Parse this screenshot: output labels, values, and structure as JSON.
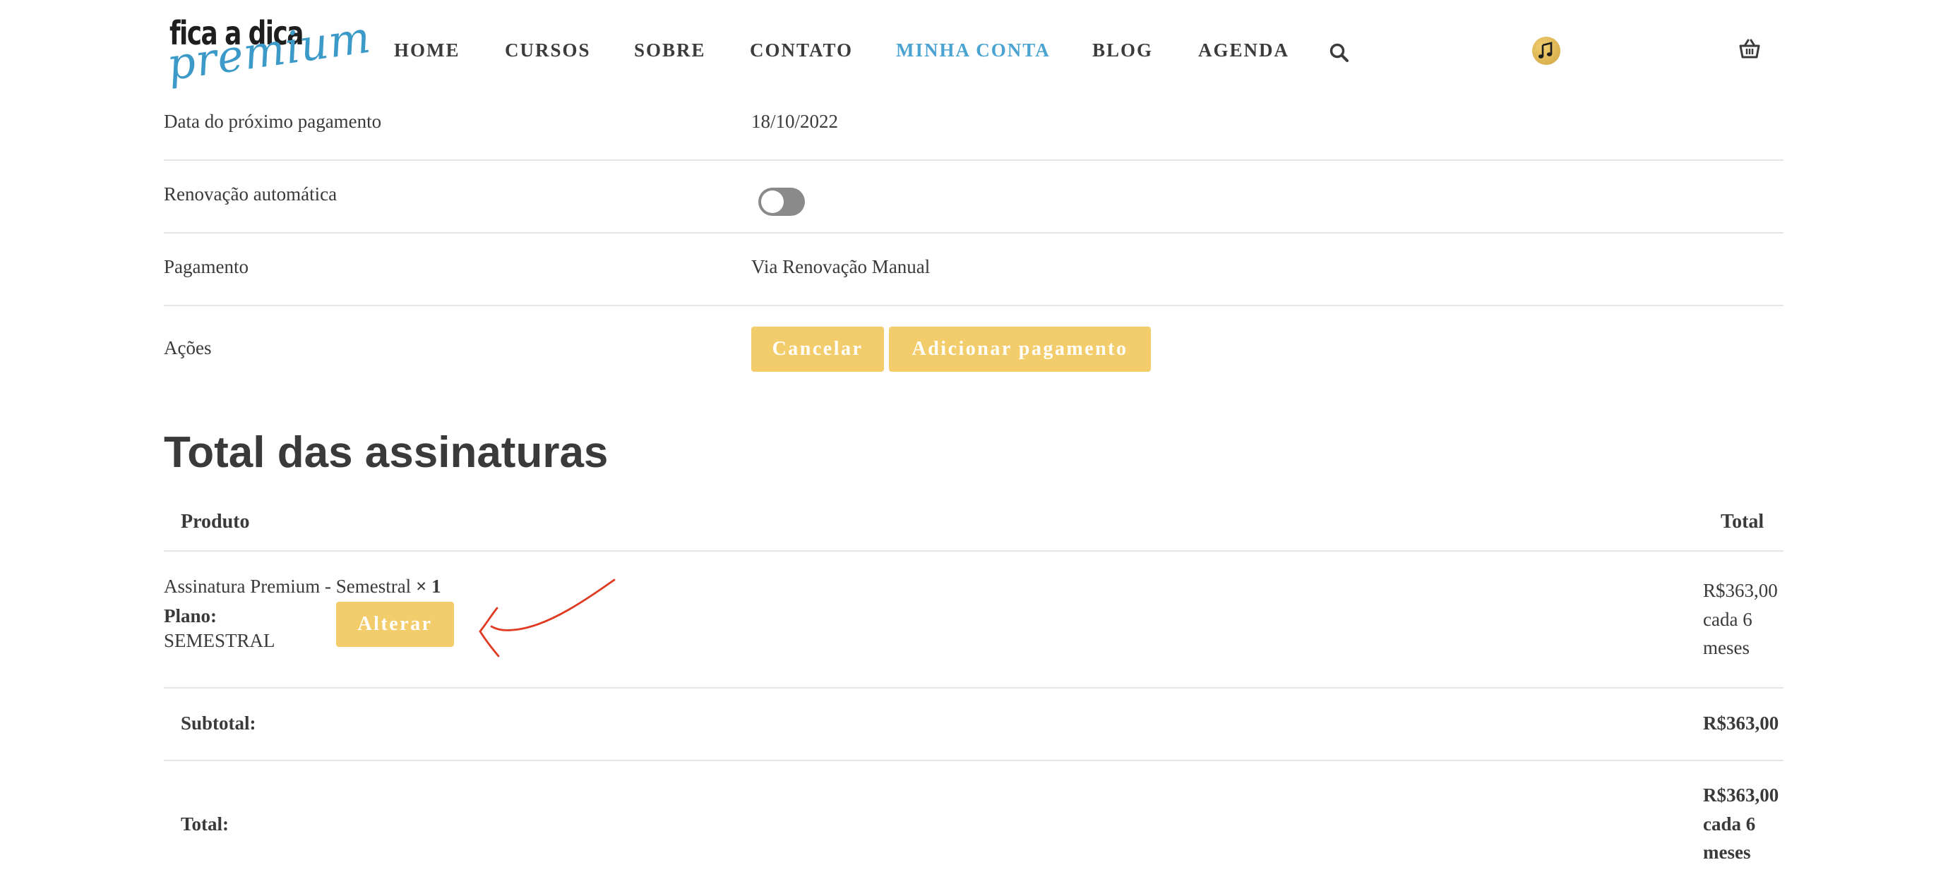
{
  "logo": {
    "top_text": "fica a dica",
    "bottom_text": "premium"
  },
  "nav": {
    "items": [
      "HOME",
      "CURSOS",
      "SOBRE",
      "CONTATO",
      "MINHA CONTA",
      "BLOG",
      "AGENDA"
    ],
    "active": "MINHA CONTA"
  },
  "details": {
    "next_payment_label": "Data do próximo pagamento",
    "next_payment_value": "18/10/2022",
    "auto_renew_label": "Renovação automática",
    "auto_renew_on": false,
    "payment_label": "Pagamento",
    "payment_value": "Via Renovação Manual",
    "actions_label": "Ações",
    "cancel_button": "Cancelar",
    "add_payment_button": "Adicionar pagamento"
  },
  "totals": {
    "title": "Total das assinaturas",
    "col_product": "Produto",
    "col_total": "Total",
    "product_name": "Assinatura Premium - Semestral",
    "product_qty": "× 1",
    "plan_label": "Plano:",
    "plan_value": "SEMESTRAL",
    "change_button": "Alterar",
    "product_price": "R$363,00",
    "product_period_1": "cada 6",
    "product_period_2": "meses",
    "subtotal_label": "Subtotal:",
    "subtotal_value": "R$363,00",
    "total_label": "Total:",
    "total_value": "R$363,00",
    "total_period_1": "cada 6",
    "total_period_2": "meses"
  },
  "colors": {
    "accent_button": "#f3cd6b",
    "nav_active": "#4ba3d2",
    "price_green": "#7cc48e",
    "annotation_red": "#e03a22"
  }
}
